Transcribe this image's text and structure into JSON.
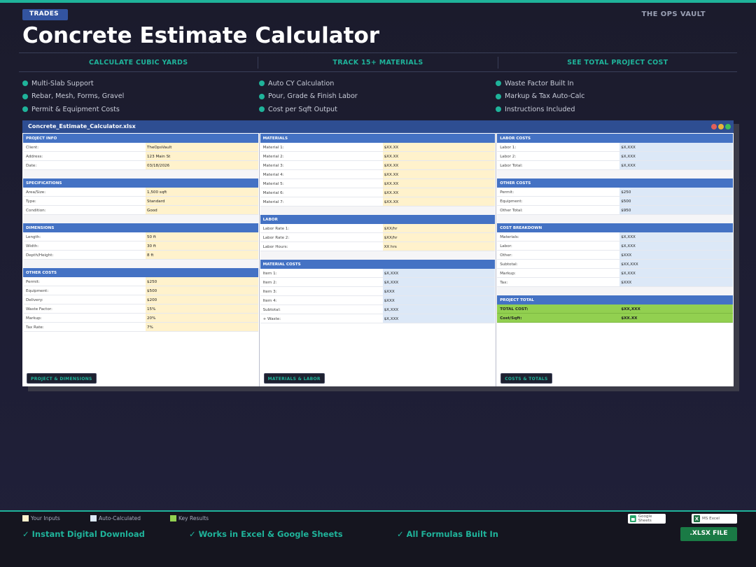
{
  "header": {
    "tag": "TRADES",
    "brand": "THE OPS VAULT",
    "title": "Concrete Estimate Calculator",
    "columns": [
      "CALCULATE CUBIC YARDS",
      "TRACK 15+ MATERIALS",
      "SEE TOTAL PROJECT COST"
    ]
  },
  "features": [
    "Multi-Slab Support",
    "Auto CY Calculation",
    "Waste Factor Built In",
    "Rebar, Mesh, Forms, Gravel",
    "Pour, Grade & Finish Labor",
    "Markup & Tax Auto-Calc",
    "Permit & Equipment Costs",
    "Cost per Sqft Output",
    "Instructions Included"
  ],
  "window": {
    "filename": "Concrete_Estimate_Calculator.xlsx",
    "light_colors": [
      "#e0605a",
      "#e8b33a",
      "#3fbf5a"
    ]
  },
  "sheet": {
    "project_info": {
      "title": "PROJECT INFO",
      "rows": [
        {
          "label": "Client:",
          "value": "TheOpsVault"
        },
        {
          "label": "Address:",
          "value": "123 Main St"
        },
        {
          "label": "Date:",
          "value": "03/18/2026"
        }
      ]
    },
    "specifications": {
      "title": "SPECIFICATIONS",
      "rows": [
        {
          "label": "Area/Size:",
          "value": "1,500 sqft"
        },
        {
          "label": "Type:",
          "value": "Standard"
        },
        {
          "label": "Condition:",
          "value": "Good"
        }
      ]
    },
    "dimensions": {
      "title": "DIMENSIONS",
      "rows": [
        {
          "label": "Length:",
          "value": "50 ft"
        },
        {
          "label": "Width:",
          "value": "30 ft"
        },
        {
          "label": "Depth/Height:",
          "value": "8 ft"
        }
      ]
    },
    "other_costs_left": {
      "title": "OTHER COSTS",
      "rows": [
        {
          "label": "Permit:",
          "value": "$250"
        },
        {
          "label": "Equipment:",
          "value": "$500"
        },
        {
          "label": "Delivery:",
          "value": "$200"
        },
        {
          "label": "Waste Factor:",
          "value": "15%"
        },
        {
          "label": "Markup:",
          "value": "20%"
        },
        {
          "label": "Tax Rate:",
          "value": "7%"
        }
      ]
    },
    "materials": {
      "title": "MATERIALS",
      "rows": [
        {
          "label": "Material 1:",
          "value": "$XX.XX"
        },
        {
          "label": "Material 2:",
          "value": "$XX.XX"
        },
        {
          "label": "Material 3:",
          "value": "$XX.XX"
        },
        {
          "label": "Material 4:",
          "value": "$XX.XX"
        },
        {
          "label": "Material 5:",
          "value": "$XX.XX"
        },
        {
          "label": "Material 6:",
          "value": "$XX.XX"
        },
        {
          "label": "Material 7:",
          "value": "$XX.XX"
        }
      ]
    },
    "labor": {
      "title": "LABOR",
      "rows": [
        {
          "label": "Labor Rate 1:",
          "value": "$XX/hr"
        },
        {
          "label": "Labor Rate 2:",
          "value": "$XX/hr"
        },
        {
          "label": "Labor Hours:",
          "value": "XX hrs"
        }
      ]
    },
    "material_costs": {
      "title": "MATERIAL COSTS",
      "rows": [
        {
          "label": "Item 1:",
          "value": "$X,XXX"
        },
        {
          "label": "Item 2:",
          "value": "$X,XXX"
        },
        {
          "label": "Item 3:",
          "value": "$XXX"
        },
        {
          "label": "Item 4:",
          "value": "$XXX"
        },
        {
          "label": "Subtotal:",
          "value": "$X,XXX"
        },
        {
          "label": "+ Waste:",
          "value": "$X,XXX"
        }
      ]
    },
    "labor_costs": {
      "title": "LABOR COSTS",
      "rows": [
        {
          "label": "Labor 1:",
          "value": "$X,XXX"
        },
        {
          "label": "Labor 2:",
          "value": "$X,XXX"
        },
        {
          "label": "Labor Total:",
          "value": "$X,XXX"
        }
      ]
    },
    "other_costs_right": {
      "title": "OTHER COSTS",
      "rows": [
        {
          "label": "Permit:",
          "value": "$250"
        },
        {
          "label": "Equipment:",
          "value": "$500"
        },
        {
          "label": "Other Total:",
          "value": "$950"
        }
      ]
    },
    "cost_breakdown": {
      "title": "COST BREAKDOWN",
      "rows": [
        {
          "label": "Materials:",
          "value": "$X,XXX"
        },
        {
          "label": "Labor:",
          "value": "$X,XXX"
        },
        {
          "label": "Other:",
          "value": "$XXX"
        },
        {
          "label": "Subtotal:",
          "value": "$XX,XXX"
        },
        {
          "label": "Markup:",
          "value": "$X,XXX"
        },
        {
          "label": "Tax:",
          "value": "$XXX"
        }
      ]
    },
    "project_total": {
      "title": "PROJECT TOTAL",
      "rows": [
        {
          "label": "TOTAL COST:",
          "value": "$XX,XXX"
        },
        {
          "label": "Cost/Sqft:",
          "value": "$XX.XX"
        }
      ]
    },
    "pane_buttons": [
      "PROJECT & DIMENSIONS",
      "MATERIALS & LABOR",
      "COSTS & TOTALS"
    ]
  },
  "legend": [
    {
      "label": "Your Inputs",
      "color": "#fff2cc"
    },
    {
      "label": "Auto-Calculated",
      "color": "#dce8f7"
    },
    {
      "label": "Key Results",
      "color": "#92d050"
    }
  ],
  "perks": [
    "✓ Instant Digital Download",
    "✓ Works in Excel & Google Sheets",
    "✓ All Formulas Built In"
  ],
  "apps": {
    "google": "Google Sheets",
    "excel": "MS Excel",
    "excel_letter": "X"
  },
  "format_button": ".XLSX FILE",
  "colors": {
    "accent": "#1fb39a",
    "header_blue": "#4472c4",
    "title_blue": "#2e4e92",
    "download_green": "#1a7a45"
  }
}
